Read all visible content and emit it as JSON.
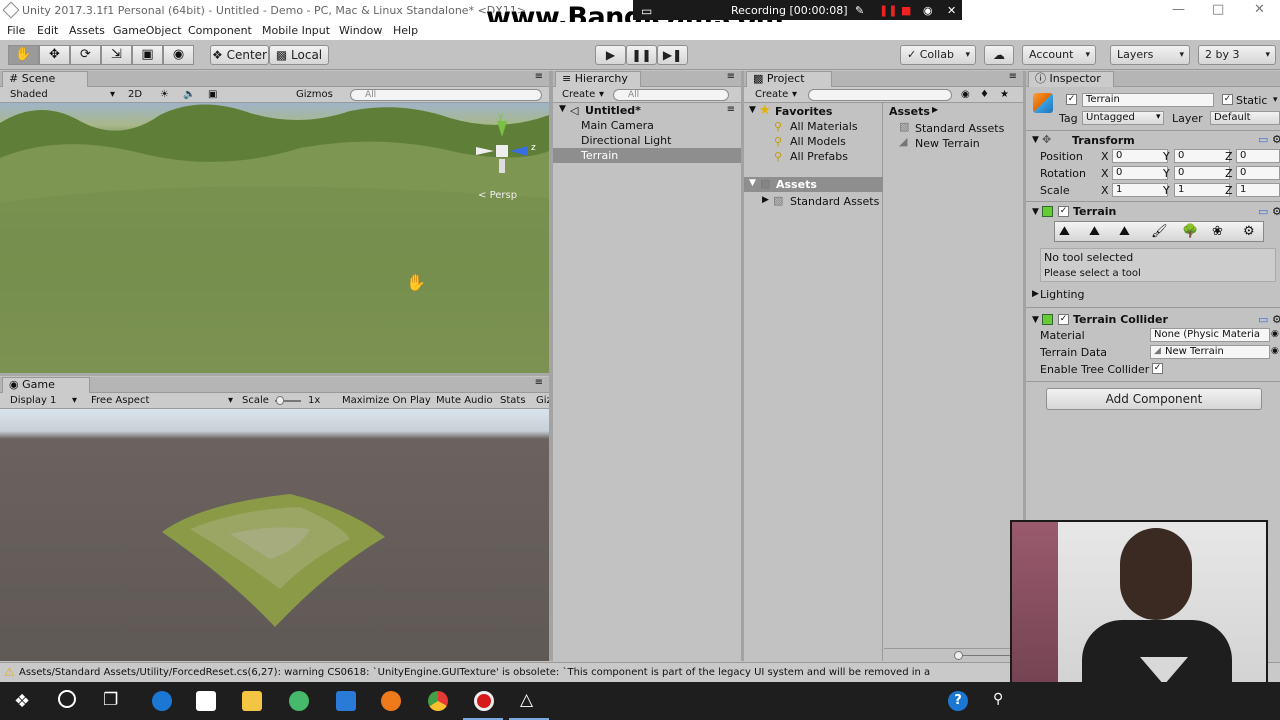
{
  "window": {
    "title": "Unity 2017.3.1f1 Personal (64bit) - Untitled - Demo - PC, Mac & Linux Standalone* <DX11>",
    "watermark": "www.Bandicam.com",
    "recording": "Recording [00:00:08]"
  },
  "menu": [
    "File",
    "Edit",
    "Assets",
    "GameObject",
    "Component",
    "Mobile Input",
    "Window",
    "Help"
  ],
  "toolbar": {
    "center": "Center",
    "local": "Local",
    "collab": "Collab",
    "account": "Account",
    "layers": "Layers",
    "layout": "2 by 3"
  },
  "scene": {
    "tab": "Scene",
    "shading": "Shaded",
    "mode2d": "2D",
    "gizmos": "Gizmos",
    "search_placeholder": "All",
    "persp": "Persp",
    "axis_y": "y",
    "axis_z": "z"
  },
  "game": {
    "tab": "Game",
    "display": "Display 1",
    "aspect": "Free Aspect",
    "scale_label": "Scale",
    "scale_value": "1x",
    "maximize": "Maximize On Play",
    "mute": "Mute Audio",
    "stats": "Stats",
    "gizmos": "Giz"
  },
  "hierarchy": {
    "tab": "Hierarchy",
    "create": "Create",
    "search_placeholder": "All",
    "scene_name": "Untitled*",
    "items": [
      "Main Camera",
      "Directional Light",
      "Terrain"
    ]
  },
  "project": {
    "tab": "Project",
    "create": "Create",
    "favorites": "Favorites",
    "favorite_items": [
      "All Materials",
      "All Models",
      "All Prefabs"
    ],
    "assets_root": "Assets",
    "assets_children": [
      "Standard Assets"
    ],
    "breadcrumb": "Assets",
    "contents": [
      "Standard Assets",
      "New Terrain"
    ]
  },
  "inspector": {
    "tab": "Inspector",
    "object_name": "Terrain",
    "static_label": "Static",
    "tag_label": "Tag",
    "tag_value": "Untagged",
    "layer_label": "Layer",
    "layer_value": "Default",
    "transform": {
      "title": "Transform",
      "rows": [
        {
          "label": "Position",
          "x": "0",
          "y": "0",
          "z": "0"
        },
        {
          "label": "Rotation",
          "x": "0",
          "y": "0",
          "z": "0"
        },
        {
          "label": "Scale",
          "x": "1",
          "y": "1",
          "z": "1"
        }
      ]
    },
    "terrain": {
      "title": "Terrain",
      "no_tool": "No tool selected",
      "select_tool": "Please select a tool"
    },
    "lighting": "Lighting",
    "collider": {
      "title": "Terrain Collider",
      "material_label": "Material",
      "material_value": "None (Physic Materia",
      "data_label": "Terrain Data",
      "data_value": "New Terrain",
      "tree_label": "Enable Tree Collider"
    },
    "add_component": "Add Component"
  },
  "console": {
    "message": "Assets/Standard Assets/Utility/ForcedReset.cs(6,27): warning CS0618: `UnityEngine.GUITexture' is obsolete: `This component is part of the legacy UI system and will be removed in a"
  },
  "taskbar": {
    "icons": [
      "windows-start",
      "cortana",
      "task-view",
      "edge",
      "mail",
      "file-explorer",
      "network-app",
      "visual-studio",
      "firefox",
      "chrome",
      "bandicam",
      "unity"
    ]
  }
}
